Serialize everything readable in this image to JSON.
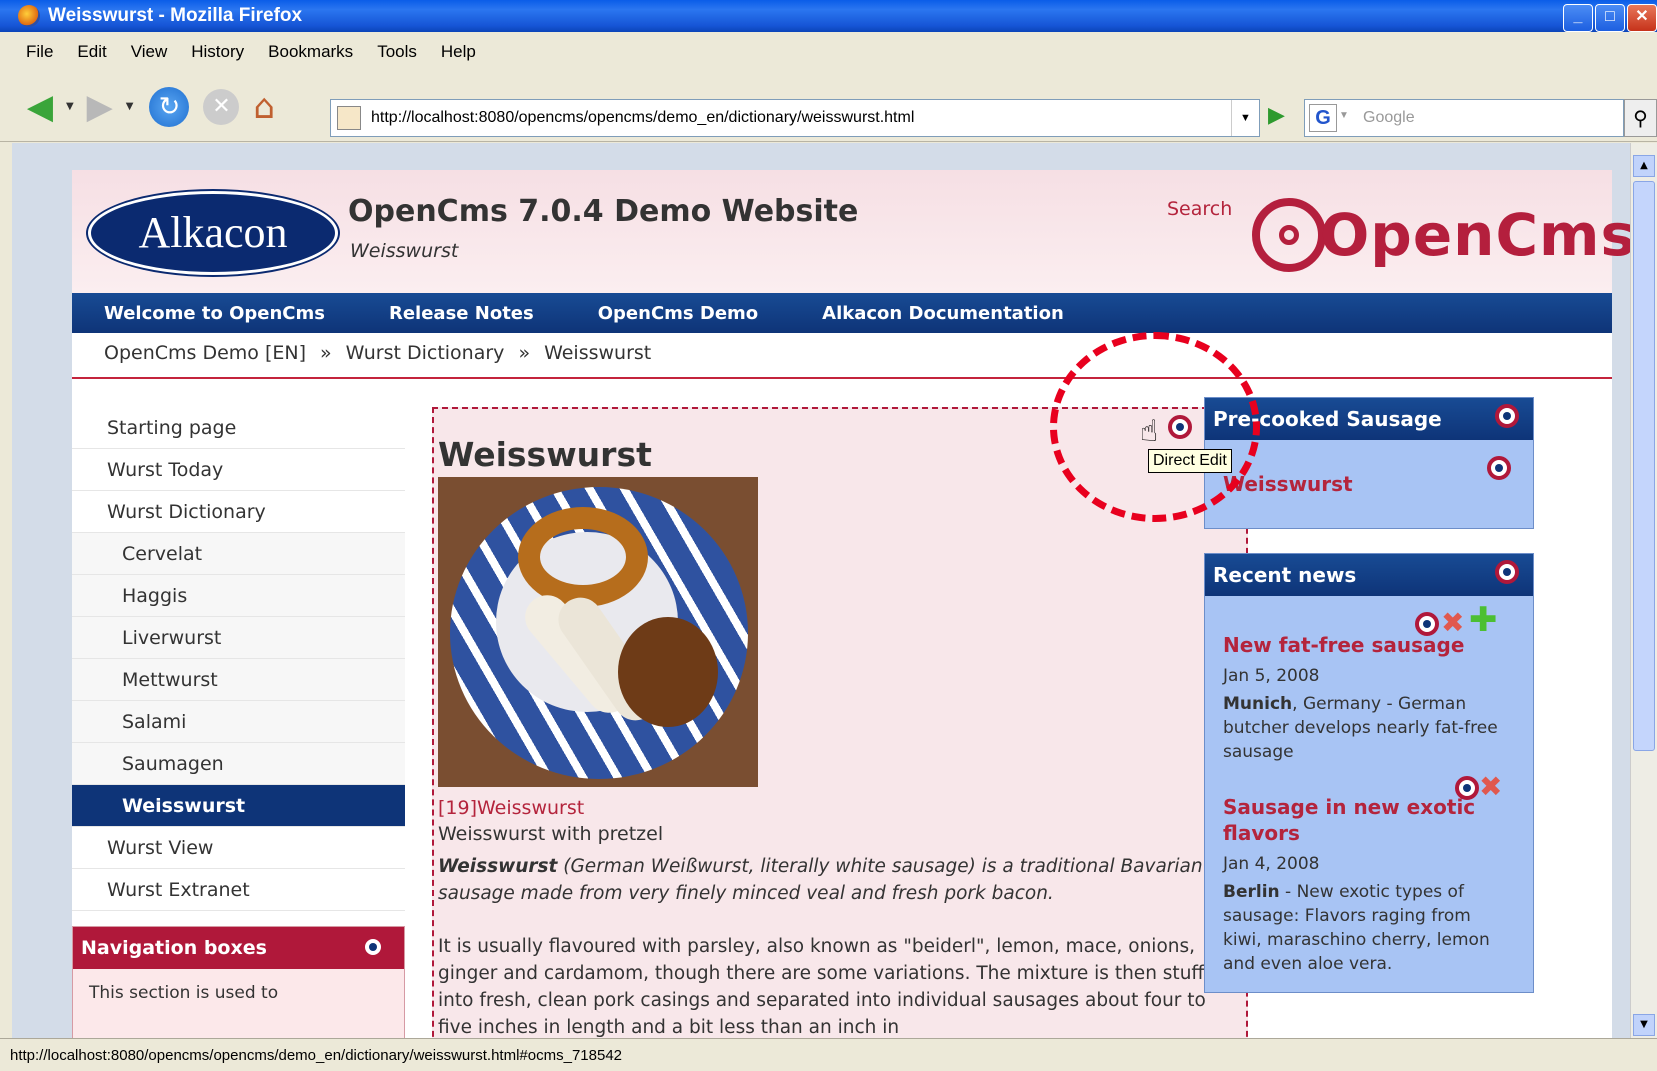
{
  "browser": {
    "title": "Weisswurst - Mozilla Firefox",
    "menu": [
      "File",
      "Edit",
      "View",
      "History",
      "Bookmarks",
      "Tools",
      "Help"
    ],
    "url": "http://localhost:8080/opencms/opencms/demo_en/dictionary/weisswurst.html",
    "search_placeholder": "Google",
    "status": "http://localhost:8080/opencms/opencms/demo_en/dictionary/weisswurst.html#ocms_718542"
  },
  "site": {
    "logo_text": "Alkacon",
    "title": "OpenCms 7.0.4 Demo Website",
    "subtitle": "Weisswurst",
    "search_label": "Search",
    "opencms_logo": "OpenCms",
    "topnav": [
      "Welcome to OpenCms",
      "Release Notes",
      "OpenCms Demo",
      "Alkacon Documentation"
    ],
    "breadcrumb": [
      "OpenCms Demo [EN]",
      "»",
      "Wurst Dictionary",
      "»",
      "Weisswurst"
    ]
  },
  "leftnav": [
    {
      "label": "Starting page",
      "sub": false,
      "active": false
    },
    {
      "label": "Wurst Today",
      "sub": false,
      "active": false
    },
    {
      "label": "Wurst Dictionary",
      "sub": false,
      "active": false
    },
    {
      "label": "Cervelat",
      "sub": true,
      "active": false
    },
    {
      "label": "Haggis",
      "sub": true,
      "active": false
    },
    {
      "label": "Liverwurst",
      "sub": true,
      "active": false
    },
    {
      "label": "Mettwurst",
      "sub": true,
      "active": false
    },
    {
      "label": "Salami",
      "sub": true,
      "active": false
    },
    {
      "label": "Saumagen",
      "sub": true,
      "active": false
    },
    {
      "label": "Weisswurst",
      "sub": true,
      "active": true
    },
    {
      "label": "Wurst View",
      "sub": false,
      "active": false
    },
    {
      "label": "Wurst Extranet",
      "sub": false,
      "active": false
    }
  ],
  "navboxes": {
    "title": "Navigation boxes",
    "body": "This section is used to"
  },
  "article": {
    "title": "Weisswurst",
    "image_caption": "[19]Weisswurst",
    "image_sub": "Weisswurst with pretzel",
    "intro_bold": "Weisswurst",
    "intro_rest": " (German Weißwurst, literally white sausage) is a traditional Bavarian sausage made from very finely minced veal and fresh pork bacon.",
    "body": "It is usually flavoured with parsley, also known as \"beiderl\", lemon, mace, onions, ginger and cardamom, though there are some variations. The mixture is then stuffed into fresh, clean pork casings and separated into individual sausages about four to five inches in length and a bit less than an inch in"
  },
  "precooked": {
    "title": "Pre-cooked Sausage",
    "link": "Weisswurst"
  },
  "recent_news": {
    "title": "Recent news",
    "items": [
      {
        "title": "New fat-free sausage",
        "date": "Jan 5, 2008",
        "place": "Munich",
        "text": ", Germany - German butcher develops nearly fat-free sausage"
      },
      {
        "title": "Sausage in new exotic flavors",
        "date": "Jan 4, 2008",
        "place": "Berlin",
        "text": " - New exotic types of sausage: Flavors raging from kiwi, maraschino cherry, lemon and even aloe vera."
      }
    ]
  },
  "tooltip": "Direct Edit",
  "colors": {
    "accent": "#b4243c",
    "nav_blue": "#0e3478",
    "box_blue": "#a8c4f4",
    "edit_area": "#f8e7ea"
  }
}
